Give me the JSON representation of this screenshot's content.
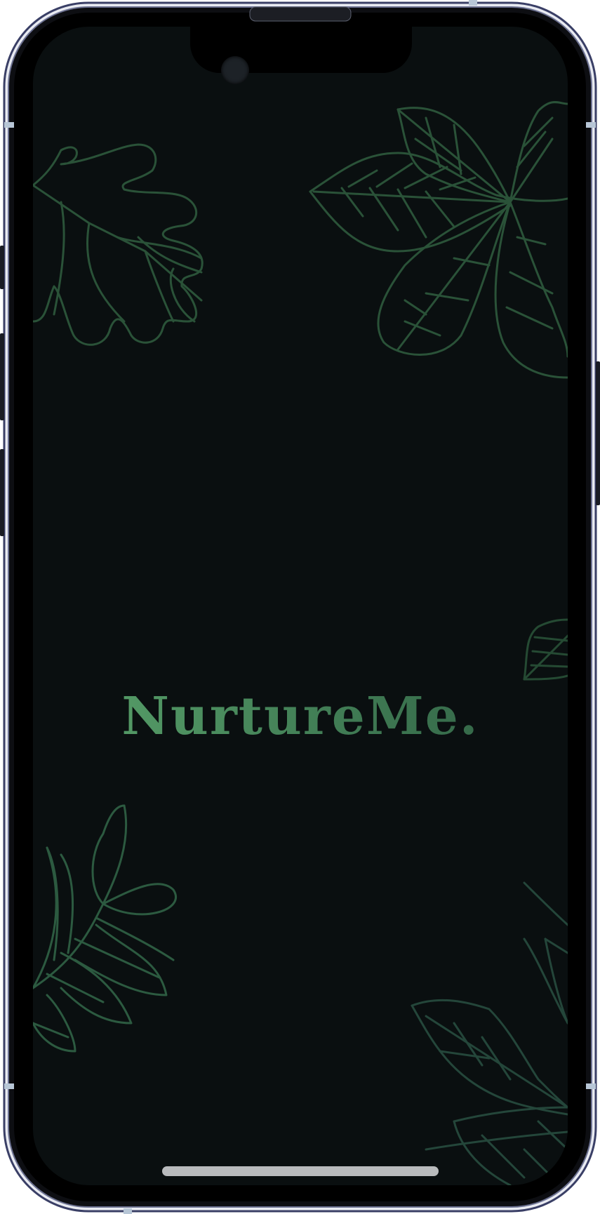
{
  "app": {
    "name": "NurtureMe."
  },
  "theme": {
    "background": "#0a0f10",
    "leaf_stroke": "#2d5a3e",
    "logo_start": "#5aa46c",
    "logo_end": "#2f5e43"
  },
  "icons": [
    "leaf-icon-top-left",
    "leaf-icon-top-right",
    "leaf-icon-middle-right",
    "leaf-icon-bottom-left",
    "leaf-icon-bottom-right"
  ]
}
